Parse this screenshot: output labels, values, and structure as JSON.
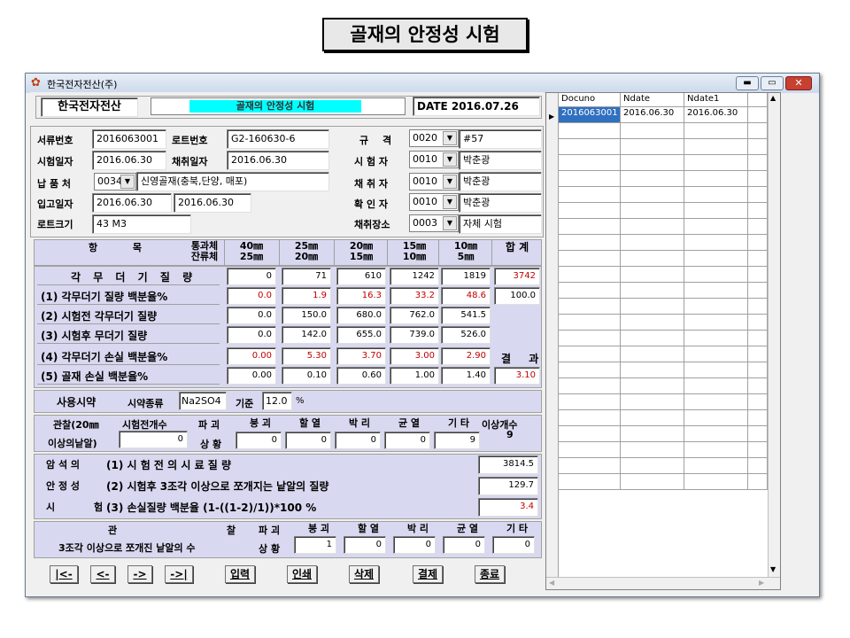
{
  "slide_title": "골재의 안정성 시험",
  "window": {
    "title": "한국전자전산(주)"
  },
  "header": {
    "company": "한국전자전산",
    "form_title": "골재의 안정성 시험",
    "date": "DATE 2016.07.26"
  },
  "info": {
    "doc_no_label": "서류번호",
    "doc_no": "2016063001",
    "lot_no_label": "로트번호",
    "lot_no": "G2-160630-6",
    "test_date_label": "시험일자",
    "test_date": "2016.06.30",
    "sample_date_label": "채취일자",
    "sample_date": "2016.06.30",
    "supplier_label": "납 품 처",
    "supplier_code": "0034",
    "supplier_name": "신영골재(충북,단양, 매포)",
    "in_date_label": "입고일자",
    "in_date1": "2016.06.30",
    "in_date2": "2016.06.30",
    "lot_size_label": "로트크기",
    "lot_size": "43 M3",
    "spec_label": "규 격",
    "spec_code": "0020",
    "spec_name": "#57",
    "tester_label": "시 험 자",
    "tester_code": "0010",
    "tester_name": "박춘광",
    "sampler_label": "채 취 자",
    "sampler_code": "0010",
    "sampler_name": "박춘광",
    "checker_label": "확 인 자",
    "checker_code": "0010",
    "checker_name": "박춘광",
    "place_label": "채취장소",
    "place_code": "0003",
    "place_name": "자체 시험"
  },
  "table": {
    "item_header": "항 목",
    "pass_label": "통과체",
    "retain_label": "잔류체",
    "sieves": [
      {
        "top": "40㎜",
        "bottom": "25㎜"
      },
      {
        "top": "25㎜",
        "bottom": "20㎜"
      },
      {
        "top": "20㎜",
        "bottom": "15㎜"
      },
      {
        "top": "15㎜",
        "bottom": "10㎜"
      },
      {
        "top": "10㎜",
        "bottom": "5㎜"
      }
    ],
    "sum_header": "합 계",
    "rows": [
      {
        "label": "각 무 더 기 질 량",
        "values": [
          "0",
          "71",
          "610",
          "1242",
          "1819"
        ],
        "total": "3742"
      },
      {
        "label": "(1) 각무더기 질량 백분율%",
        "values": [
          "0.0",
          "1.9",
          "16.3",
          "33.2",
          "48.6"
        ],
        "total": "100.0"
      },
      {
        "label": "(2) 시험전 각무더기 질량",
        "values": [
          "0.0",
          "150.0",
          "680.0",
          "762.0",
          "541.5"
        ],
        "total": ""
      },
      {
        "label": "(3) 시험후 무더기 질량",
        "values": [
          "0.0",
          "142.0",
          "655.0",
          "739.0",
          "526.0"
        ],
        "total": ""
      },
      {
        "label": "(4) 각무더기 손실 백분율%",
        "values": [
          "0.00",
          "5.30",
          "3.70",
          "3.00",
          "2.90"
        ],
        "total": ""
      },
      {
        "label": "(5) 골재 손실 백분율%",
        "values": [
          "0.00",
          "0.10",
          "0.60",
          "1.00",
          "1.40"
        ],
        "total": "3.10"
      }
    ],
    "result_label": "결 과"
  },
  "reagent": {
    "label": "사용시약",
    "type_label": "시약종류",
    "type": "Na2SO4",
    "temp_label": "기준",
    "temp": "12.0",
    "temp_unit": "%"
  },
  "observe": {
    "label1": "관찰(20㎜",
    "label2": "이상의낱알)",
    "before_count_label": "시험전개수",
    "before_count": "0",
    "state_label1": "파 괴",
    "state_label2": "상 황",
    "cols": [
      "붕 괴",
      "할 열",
      "박 리",
      "균 열",
      "기 타"
    ],
    "values": [
      "0",
      "0",
      "0",
      "0",
      "9"
    ],
    "abnormal_label": "이상개수",
    "abnormal": "9"
  },
  "calc": {
    "side": [
      "암 석 의",
      "안 정 성",
      "시 험"
    ],
    "lines": [
      {
        "label": "(1) 시 험 전 의  시 료 질 량",
        "value": "3814.5"
      },
      {
        "label": "(2) 시험후 3조각 이상으로 쪼개지는 낱알의 질량",
        "value": "129.7"
      },
      {
        "label": "(3) 손실질량 백분율 (1-((1-2)/1))*100 %",
        "value": "3.4"
      }
    ]
  },
  "observe2": {
    "title": "관 찰",
    "label": "3조각 이상으로 쪼개진 낱알의 수",
    "state_label1": "파 괴",
    "state_label2": "상 황",
    "cols": [
      "붕 괴",
      "할 열",
      "박 리",
      "균 열",
      "기 타"
    ],
    "values": [
      "1",
      "0",
      "0",
      "0",
      "0"
    ]
  },
  "buttons": {
    "first": "|<-",
    "prev": "<-",
    "next": "->",
    "last": "->|",
    "input": "입력",
    "print": "인쇄",
    "delete": "삭제",
    "approve": "결제",
    "close": "종료"
  },
  "grid": {
    "columns": [
      "Docuno",
      "Ndate",
      "Ndate1"
    ],
    "rows": [
      [
        "2016063001",
        "2016.06.30",
        "2016.06.30"
      ]
    ]
  },
  "colors": {
    "title_bar": "#dde8f5",
    "panel": "#d8d8f0",
    "highlight": "#00ffff",
    "red": "#c00000"
  }
}
